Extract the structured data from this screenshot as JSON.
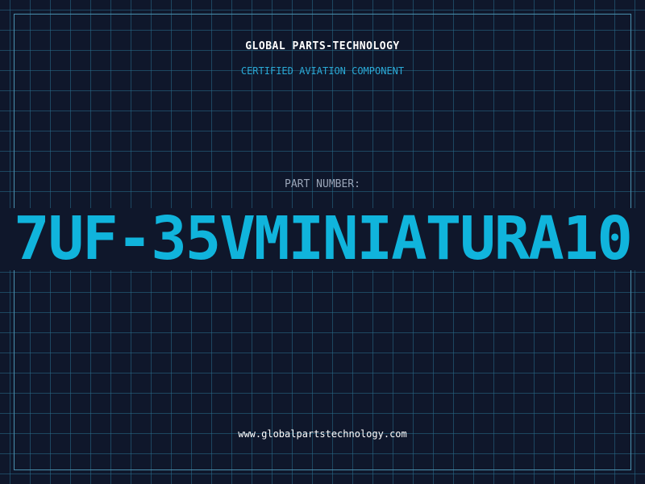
{
  "brand": {
    "name": "GLOBAL PARTS-TECHNOLOGY",
    "tagline": "CERTIFIED AVIATION COMPONENT"
  },
  "part": {
    "label": "PART NUMBER:",
    "number": "7UF-35VMINIATURA10"
  },
  "footer": {
    "website": "www.globalpartstechnology.com"
  },
  "colors": {
    "background": "#0f172b",
    "grid": "#286e8c",
    "accent": "#10b4dc",
    "tagline": "#2aa9d6",
    "label": "#9aa5b8",
    "text": "#ffffff"
  }
}
